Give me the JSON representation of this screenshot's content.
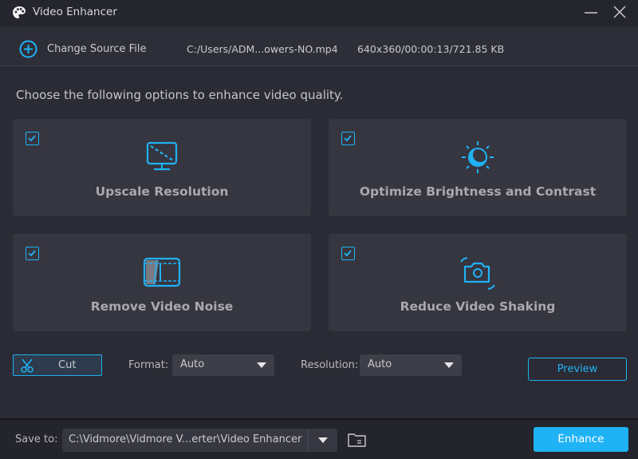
{
  "window": {
    "title": "Video Enhancer",
    "icon": "palette-icon",
    "controls": [
      "minimize-icon",
      "close-icon"
    ]
  },
  "source": {
    "change_label": "Change Source File",
    "file_path": "C:/Users/ADM...owers-NO.mp4",
    "file_info": "640x360/00:00:13/721.85 KB"
  },
  "main": {
    "instruction": "Choose the following options to enhance video quality.",
    "options": [
      {
        "label": "Upscale Resolution",
        "icon": "monitor-icon",
        "checked": true
      },
      {
        "label": "Optimize Brightness and Contrast",
        "icon": "brightness-icon",
        "checked": true
      },
      {
        "label": "Remove Video Noise",
        "icon": "film-noise-icon",
        "checked": true
      },
      {
        "label": "Reduce Video Shaking",
        "icon": "camera-shake-icon",
        "checked": true
      }
    ]
  },
  "controls": {
    "cut_label": "Cut",
    "format_label": "Format:",
    "format_value": "Auto",
    "resolution_label": "Resolution:",
    "resolution_value": "Auto",
    "preview_label": "Preview"
  },
  "footer": {
    "save_label": "Save to:",
    "save_path": "C:\\Vidmore\\Vidmore V...erter\\Video Enhancer",
    "enhance_label": "Enhance"
  },
  "colors": {
    "accent": "#1fb2f5",
    "background": "#2b2b35",
    "card": "#363640"
  }
}
